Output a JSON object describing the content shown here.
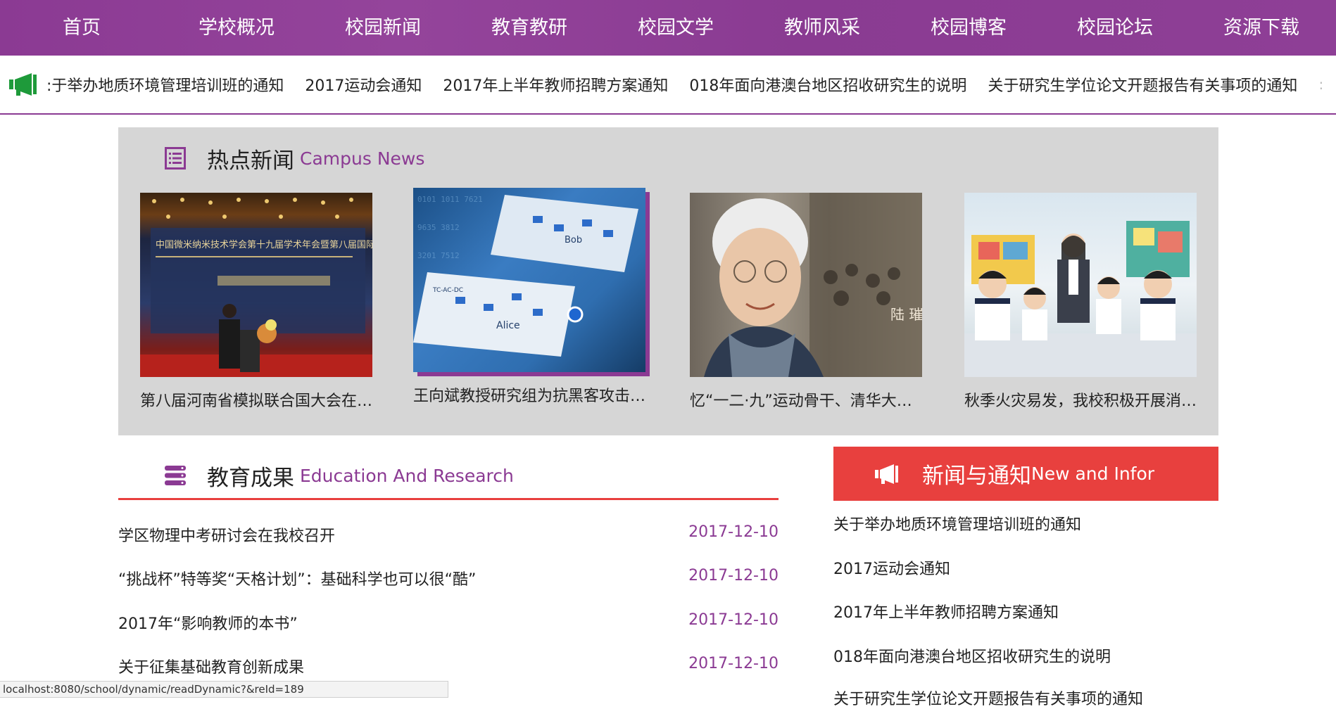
{
  "nav": {
    "items": [
      "首页",
      "学校概况",
      "校园新闻",
      "教育教研",
      "校园文学",
      "教师风采",
      "校园博客",
      "校园论坛",
      "资源下载"
    ]
  },
  "ticker": {
    "icon": "megaphone-icon",
    "items": [
      ":于举办地质环境管理培训班的通知",
      "2017运动会通知",
      "2017年上半年教师招聘方案通知",
      "018年面向港澳台地区招收研究生的说明",
      "关于研究生学位论文开题报告有关事项的通知"
    ],
    "trailing": ":"
  },
  "hot_news": {
    "title_cn": "热点新闻",
    "title_en": "Campus News",
    "icon": "list-icon",
    "cards": [
      {
        "caption": "第八届河南省模拟联合国大会在…",
        "image": "conference-photo"
      },
      {
        "caption": "王向斌教授研究组为抗黑客攻击…",
        "image": "quantum-circuit-illustration"
      },
      {
        "caption": "忆“一二·九”运动骨干、清华大学…",
        "image": "elderly-woman-portrait"
      },
      {
        "caption": "秋季火灾易发，我校积极开展消…",
        "image": "classroom-students"
      }
    ],
    "thumb_text": {
      "conference_banner": "中国微米纳米技术学会第十九届学术年会暨第八届国际会议",
      "bob": "Bob",
      "alice": "Alice",
      "tcacdc": "TC-AC-DC",
      "portrait_chars": "陆 璀"
    }
  },
  "education": {
    "title_cn": "教育成果",
    "title_en": "Education And Research",
    "icon": "stack-icon",
    "rows": [
      {
        "title": "学区物理中考研讨会在我校召开",
        "date": "2017-12-10"
      },
      {
        "title": "“挑战杯”特等奖“天格计划”：基础科学也可以很“酷”",
        "date": "2017-12-10"
      },
      {
        "title": "2017年“影响教师的本书”",
        "date": "2017-12-10"
      },
      {
        "title": "关于征集基础教育创新成果",
        "date": "2017-12-10"
      }
    ]
  },
  "notices": {
    "title_cn": "新闻与通知",
    "title_en": "New and Infor",
    "icon": "megaphone-icon",
    "items": [
      "关于举办地质环境管理培训班的通知",
      "2017运动会通知",
      "2017年上半年教师招聘方案通知",
      "018年面向港澳台地区招收研究生的说明",
      "关于研究生学位论文开题报告有关事项的通知"
    ]
  },
  "status_bar": {
    "url": "localhost:8080/school/dynamic/readDynamic?&reId=189"
  },
  "colors": {
    "nav_purple": "#8b3a93",
    "accent_red": "#e8403e",
    "ticker_green": "#1e9a3a",
    "panel_gray": "#d6d6d6"
  }
}
